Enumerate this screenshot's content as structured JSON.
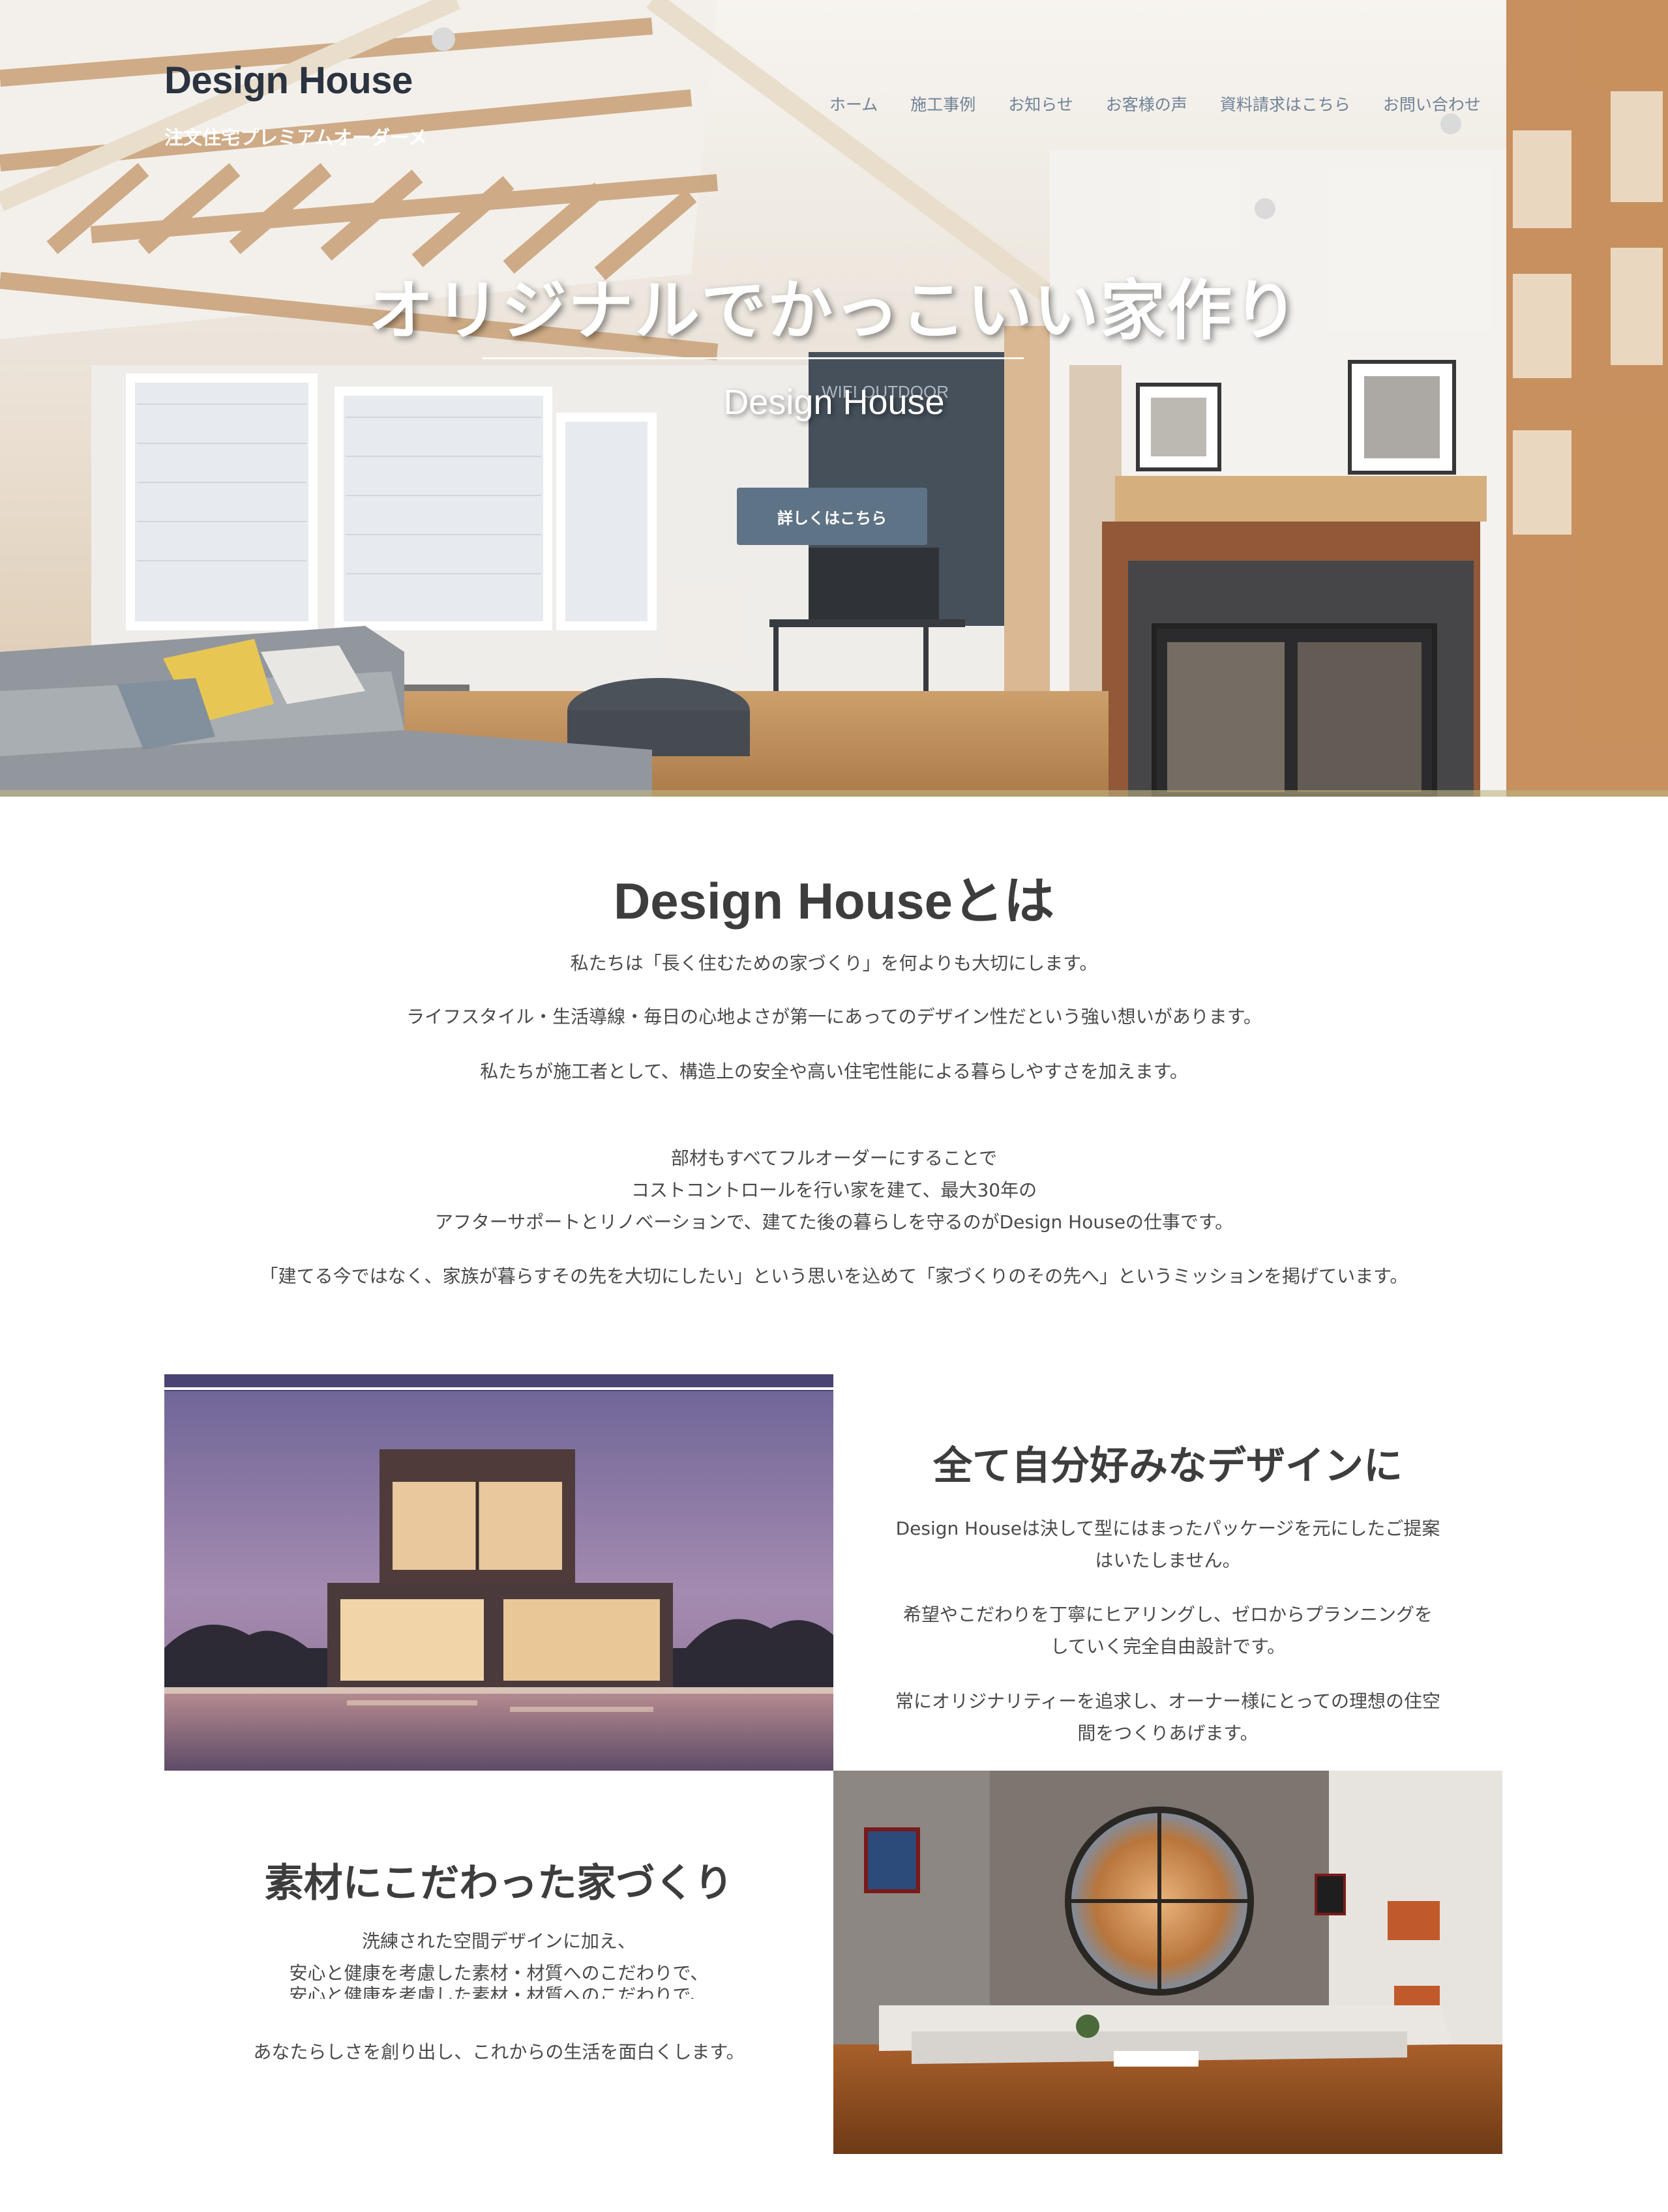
{
  "header": {
    "site_title": "Design House",
    "tagline": "注文住宅プレミアムオーダーメ",
    "nav": [
      "ホーム",
      "施工事例",
      "お知らせ",
      "お客様の声",
      "資料請求はこちら",
      "お問い合わせ"
    ]
  },
  "hero": {
    "title": "オリジナルでかっこいい家作り",
    "subtitle": "Design House",
    "button_label": "詳しくはこちら",
    "wall_sign": "WIFI OUTDOOR"
  },
  "about": {
    "title": "Design Houseとは",
    "p1": "私たちは「長く住むための家づくり」を何よりも大切にします。",
    "p2": "ライフスタイル・生活導線・毎日の心地よさが第一にあってのデザイン性だという強い想いがあります。",
    "p3": "私たちが施工者として、構造上の安全や高い住宅性能による暮らしやすさを加えます。",
    "p4_line1": "部材もすべてフルオーダーにすることで",
    "p4_line2": "コストコントロールを行い家を建て、最大30年の",
    "p4_line3": "アフターサポートとリノベーションで、建てた後の暮らしを守るのがDesign Houseの仕事です。",
    "p5": "「建てる今ではなく、家族が暮らすその先を大切にしたい」という思いを込めて「家づくりのその先へ」というミッションを掲げています。"
  },
  "feature1": {
    "heading": "全て自分好みなデザインに",
    "p1_line1": "Design Houseは決して型にはまったパッケージを元にしたご提案",
    "p1_line2": "はいたしません。",
    "p2_line1": "希望やこだわりを丁寧にヒアリングし、ゼロからプランニングを",
    "p2_line2": "していく完全自由設計です。",
    "p3_line1": "常にオリジナリティーを追求し、オーナー様にとっての理想の住空",
    "p3_line2": "間をつくりあげます。"
  },
  "feature2": {
    "heading": "素材にこだわった家づくり",
    "p1_line1": "洗練された空間デザインに加え、",
    "p1_line2": "安心と健康を考慮した素材・材質へのこだわりで、",
    "p1_line3": "安心と健康を考慮した素材・材質へのこだわりで、",
    "p2": "あなたらしさを創り出し、これからの生活を面白くします。"
  },
  "colors": {
    "button": "#5f7386",
    "nav": "#6f8398",
    "site_title": "#2b3340",
    "heading": "#3d3d3d",
    "body_text": "#4a4a4a"
  }
}
